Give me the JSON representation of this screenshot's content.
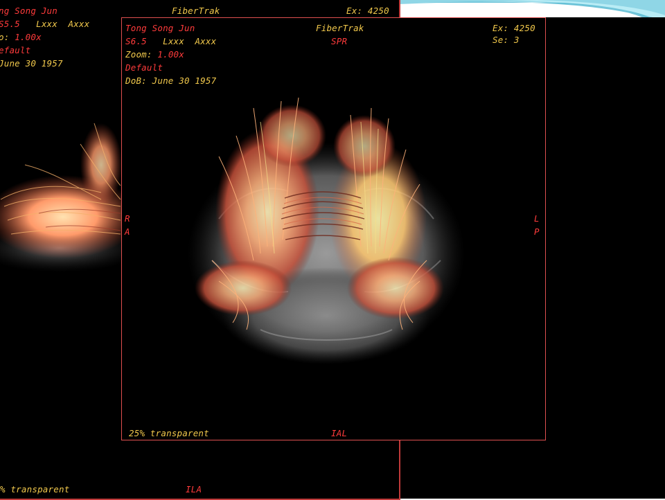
{
  "back_view": {
    "patient_name": "ng Song Jun",
    "series_line": {
      "series": "S5.5",
      "l": "Lxxx",
      "a": "Axxx"
    },
    "zoom_label": "o:",
    "zoom_value": "1.00x",
    "preset": "efault",
    "dob": "June 30 1957",
    "app_title": "FiberTrak",
    "exam": "Ex: 4250",
    "transparency": "% transparent",
    "orientation_bottom": "ILA"
  },
  "front_view": {
    "patient_name": "Tong Song Jun",
    "series_line": {
      "series": "S6.5",
      "l": "Lxxx",
      "a": "Axxx"
    },
    "zoom_label": "Zoom:",
    "zoom_value": "1.00x",
    "preset": "Default",
    "dob": "DoB: June 30 1957",
    "app_title": "FiberTrak",
    "orientation_top": "SPR",
    "exam": "Ex: 4250",
    "series_number": "Se: 3",
    "orientation_left": [
      "R",
      "A"
    ],
    "orientation_right": [
      "L",
      "P"
    ],
    "transparency": "25% transparent",
    "orientation_bottom": "IAL"
  },
  "colors": {
    "overlay_red": "#ff3b3b",
    "overlay_yellow": "#f2c94c",
    "viewport_border": "#e05050",
    "background": "#000000",
    "deco_teal": "#6fc9dc"
  }
}
